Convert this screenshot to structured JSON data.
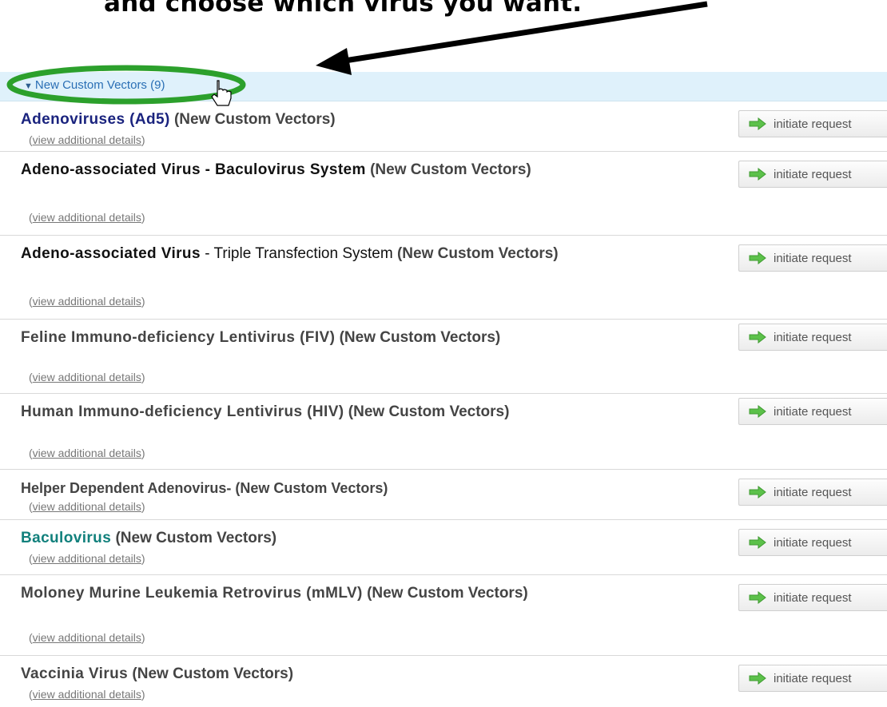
{
  "instruction": {
    "text": "and choose which virus you want."
  },
  "group_header": {
    "label": "New Custom Vectors (9)",
    "arrow_glyph": "▼",
    "bg_color": "#dff1fb",
    "link_color": "#2a6fb5"
  },
  "annotation": {
    "ellipse_color": "#2ca02c",
    "arrow_color": "#000000"
  },
  "common": {
    "details_prefix": "(",
    "details_link": "view additional details",
    "details_suffix": ")",
    "button_label": "initiate request",
    "button_icon": "right-arrow-icon",
    "button_icon_color": "#5cc14a"
  },
  "items": [
    {
      "name": "Adenoviruses (Ad5)",
      "name_rest": "",
      "category": "(New Custom Vectors)"
    },
    {
      "name": "Adeno-associated Virus - Baculovirus System",
      "name_rest": "",
      "category": "(New Custom Vectors)"
    },
    {
      "name": "Adeno-associated Virus",
      "name_rest": " - Triple Transfection System",
      "category": "(New Custom Vectors)"
    },
    {
      "name": "Feline Immuno-deficiency Lentivirus (FIV)",
      "name_rest": "",
      "category": "(New Custom Vectors)"
    },
    {
      "name": "Human Immuno-deficiency Lentivirus (HIV)",
      "name_rest": "",
      "category": "(New Custom Vectors)"
    },
    {
      "name": "Helper Dependent Adenovirus-",
      "name_rest": "",
      "category": "(New Custom Vectors)"
    },
    {
      "name": "Baculovirus",
      "name_rest": "",
      "category": "(New Custom Vectors)"
    },
    {
      "name": "Moloney Murine Leukemia Retrovirus (mMLV)",
      "name_rest": "",
      "category": "(New Custom Vectors)"
    },
    {
      "name": "Vaccinia Virus",
      "name_rest": "",
      "category": "(New Custom Vectors)"
    }
  ]
}
